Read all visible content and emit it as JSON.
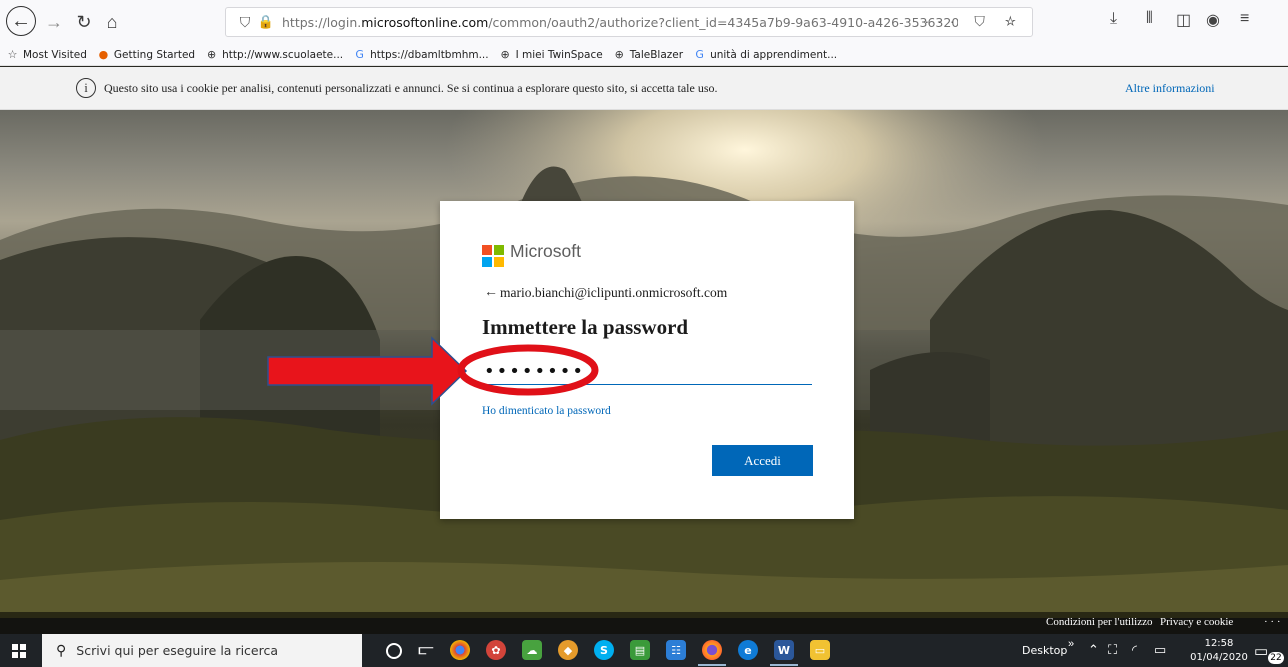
{
  "browser": {
    "url_prefix": "https://login.",
    "url_domain": "microsoftonline.com",
    "url_rest": "/common/oauth2/authorize?client_id=4345a7b9-9a63-4910-a426-3536320",
    "page_actions": "··· ⛉ ☆",
    "bookmarks": [
      {
        "icon": "☆",
        "label": "Most Visited",
        "color": "#444"
      },
      {
        "icon": "●",
        "label": "Getting Started",
        "color": "#e66000"
      },
      {
        "icon": "⊕",
        "label": "http://www.scuolaete...",
        "color": "#333"
      },
      {
        "icon": "G",
        "label": "https://dbamltbmhm...",
        "color": "#4285f4"
      },
      {
        "icon": "⊕",
        "label": "I miei TwinSpace",
        "color": "#333"
      },
      {
        "icon": "⊕",
        "label": "TaleBlazer",
        "color": "#333"
      },
      {
        "icon": "G",
        "label": "unità di apprendiment...",
        "color": "#4285f4"
      }
    ]
  },
  "cookie_banner": {
    "text": "Questo sito usa i cookie per analisi, contenuti personalizzati e annunci. Se si continua a esplorare questo sito, si accetta tale uso.",
    "more": "Altre informazioni"
  },
  "login": {
    "brand": "Microsoft",
    "logo_colors": [
      "#f25022",
      "#7fba00",
      "#00a4ef",
      "#ffb900"
    ],
    "account": "mario.bianchi@iclipunti.onmicrosoft.com",
    "title": "Immettere la password",
    "password_value": "••••••••",
    "forgot": "Ho dimenticato la password",
    "submit": "Accedi"
  },
  "footer": {
    "terms": "Condizioni per l'utilizzo",
    "privacy": "Privacy e cookie",
    "more": "· · ·"
  },
  "annotation": {
    "arrow_color": "#e8141b",
    "ellipse_color": "#e01018"
  },
  "taskbar": {
    "search_placeholder": "Scrivi qui per eseguire la ricerca",
    "desktop": "Desktop",
    "time": "12:58",
    "date": "01/04/2020",
    "notifications": "22"
  }
}
